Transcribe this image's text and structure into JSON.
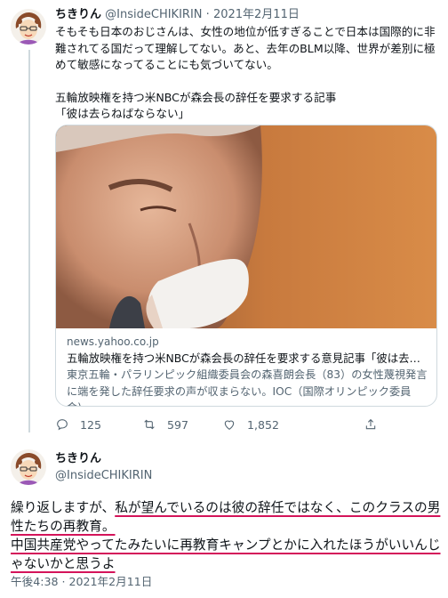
{
  "tweet1": {
    "author_name": "ちきりん",
    "author_handle": "@InsideCHIKIRIN",
    "separator": "·",
    "date": "2021年2月11日",
    "body_paragraph1": "そもそも日本のおじさんは、女性の地位が低すぎることで日本は国際的に非難されてる国だって理解してない。あと、去年のBLM以降、世界が差別に極めて敏感になってることにも気づいてない。",
    "body_paragraph2": "五輪放映権を持つ米NBCが森会長の辞任を要求する記事\n「彼は去らねばならない」",
    "card": {
      "domain": "news.yahoo.co.jp",
      "title": "五輪放映権を持つ米NBCが森会長の辞任を要求する意見記事「彼は去らね...",
      "description": "東京五輪・パラリンピック組織委員会の森喜朗会長（83）の女性蔑視発言に端を発した辞任要求の声が収まらない。IOC（国際オリンピック委員会)..."
    },
    "actions": {
      "reply_icon": "reply-icon",
      "reply_count": "125",
      "retweet_icon": "retweet-icon",
      "retweet_count": "597",
      "like_icon": "heart-icon",
      "like_count": "1,852",
      "share_icon": "share-icon"
    }
  },
  "tweet2": {
    "author_name": "ちきりん",
    "author_handle": "@InsideCHIKIRIN",
    "body_part1": "繰り返しますが、",
    "body_part2": "私が望んでいるのは彼の辞任ではなく、このクラスの男性たちの再教育。",
    "body_part3": "中国共産党やってたみたいに再教育キャンプとかに入れたほうがいいんじゃないかと思うよ",
    "timestamp": "午後4:38 · 2021年2月11日"
  },
  "colors": {
    "text_primary": "#0f1419",
    "text_secondary": "#536471",
    "border": "#cfd9de",
    "underline_accent": "#d4145a"
  }
}
